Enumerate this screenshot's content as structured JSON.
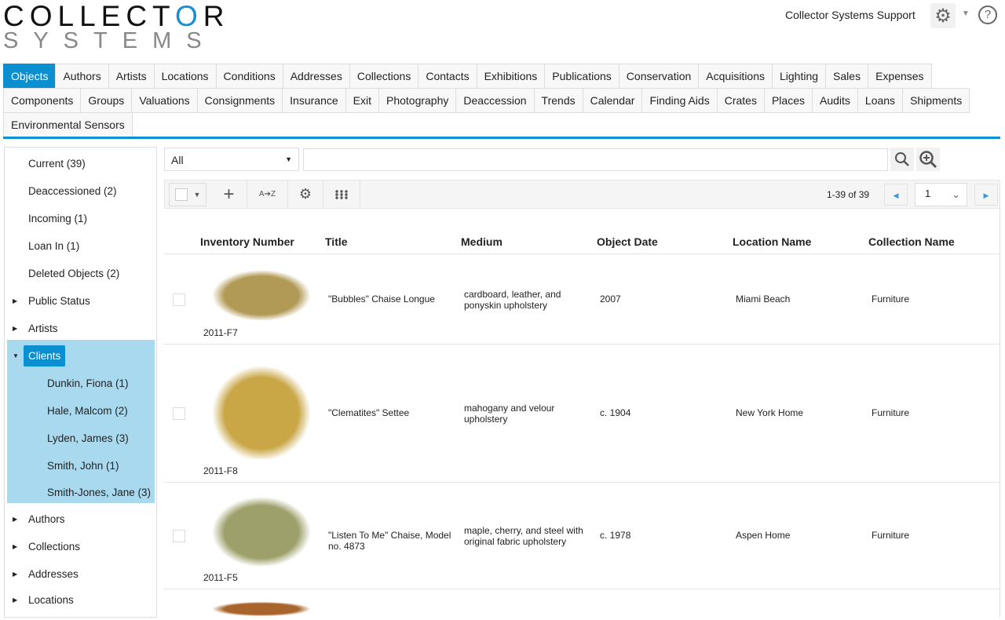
{
  "header": {
    "logo_top": "COLLECTOR",
    "logo_bottom": "SYSTEMS",
    "user": "Collector Systems Support"
  },
  "tabs": {
    "row1": [
      "Objects",
      "Authors",
      "Artists",
      "Locations",
      "Conditions",
      "Addresses",
      "Collections",
      "Contacts",
      "Exhibitions",
      "Publications",
      "Conservation",
      "Acquisitions",
      "Lighting",
      "Sales",
      "Expenses"
    ],
    "row2": [
      "Components",
      "Groups",
      "Valuations",
      "Consignments",
      "Insurance",
      "Exit",
      "Photography",
      "Deaccession",
      "Trends",
      "Calendar",
      "Finding Aids",
      "Crates",
      "Places",
      "Audits",
      "Loans",
      "Shipments"
    ],
    "row3": [
      "Environmental Sensors"
    ]
  },
  "sidebar": {
    "items": [
      "Current (39)",
      "Deaccessioned (2)",
      "Incoming (1)",
      "Loan In (1)",
      "Deleted Objects (2)",
      "Public Status",
      "Artists",
      "Clients",
      "Dunkin, Fiona (1)",
      "Hale, Malcom (2)",
      "Lyden, James (3)",
      "Smith, John (1)",
      "Smith-Jones, Jane (3)",
      "Authors",
      "Collections",
      "Addresses",
      "Locations"
    ]
  },
  "filter": {
    "value": "All",
    "search_value": ""
  },
  "toolbar": {
    "sort_label": "A➔Z",
    "count": "1-39 of 39",
    "page": "1"
  },
  "table": {
    "columns": [
      "Inventory Number",
      "Title",
      "Medium",
      "Object Date",
      "Location Name",
      "Collection Name"
    ],
    "rows": [
      {
        "inv": "2011-F7",
        "title": "\"Bubbles\" Chaise Longue",
        "medium": "cardboard, leather, and ponyskin upholstery",
        "date": "2007",
        "location": "Miami Beach",
        "collection": "Furniture"
      },
      {
        "inv": "2011-F8",
        "title": "\"Clematites\" Settee",
        "medium": "mahogany and velour upholstery",
        "date": "c. 1904",
        "location": "New York Home",
        "collection": "Furniture"
      },
      {
        "inv": "2011-F5",
        "title": "\"Listen To Me\" Chaise, Model no. 4873",
        "medium": "maple, cherry, and steel with original fabric upholstery",
        "date": "c. 1978",
        "location": "Aspen Home",
        "collection": "Furniture"
      }
    ]
  },
  "colors": {
    "accent": "#0a8fd0",
    "highlight": "#a9d9ef"
  }
}
